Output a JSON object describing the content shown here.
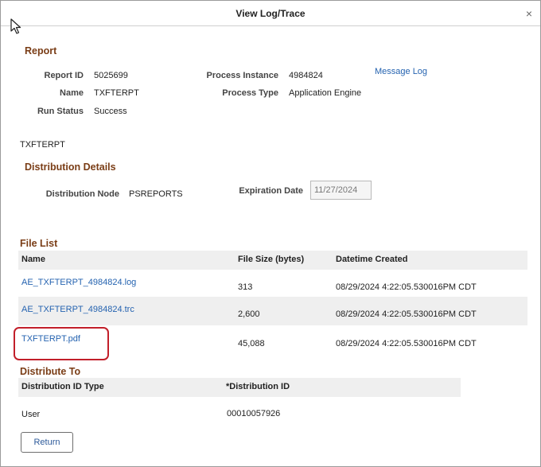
{
  "dialog": {
    "title": "View Log/Trace",
    "close": "×"
  },
  "report": {
    "heading": "Report",
    "report_id_label": "Report ID",
    "report_id": "5025699",
    "name_label": "Name",
    "name": "TXFTERPT",
    "run_status_label": "Run Status",
    "run_status": "Success",
    "process_instance_label": "Process Instance",
    "process_instance": "4984824",
    "process_type_label": "Process Type",
    "process_type": "Application Engine",
    "message_log_link": "Message Log"
  },
  "report_name_text": "TXFTERPT",
  "distribution": {
    "heading": "Distribution Details",
    "node_label": "Distribution Node",
    "node": "PSREPORTS",
    "expiration_label": "Expiration Date",
    "expiration": "11/27/2024"
  },
  "file_list": {
    "heading": "File List",
    "columns": {
      "name": "Name",
      "size": "File Size (bytes)",
      "datetime": "Datetime Created"
    },
    "rows": [
      {
        "name": "AE_TXFTERPT_4984824.log",
        "size": "313",
        "datetime": "08/29/2024  4:22:05.530016PM CDT"
      },
      {
        "name": "AE_TXFTERPT_4984824.trc",
        "size": "2,600",
        "datetime": "08/29/2024  4:22:05.530016PM CDT"
      },
      {
        "name": "TXFTERPT.pdf",
        "size": "45,088",
        "datetime": "08/29/2024  4:22:05.530016PM CDT"
      }
    ]
  },
  "distribute_to": {
    "heading": "Distribute To",
    "columns": {
      "type": "Distribution ID Type",
      "id": "*Distribution ID"
    },
    "rows": [
      {
        "type": "User",
        "id": "00010057926"
      }
    ]
  },
  "return_button": "Return",
  "colors": {
    "section": "#7a3d16",
    "link": "#2563b0",
    "highlight": "#c21f2a"
  },
  "icons": {
    "cursor": "mouse-pointer-icon",
    "close": "close-icon"
  }
}
